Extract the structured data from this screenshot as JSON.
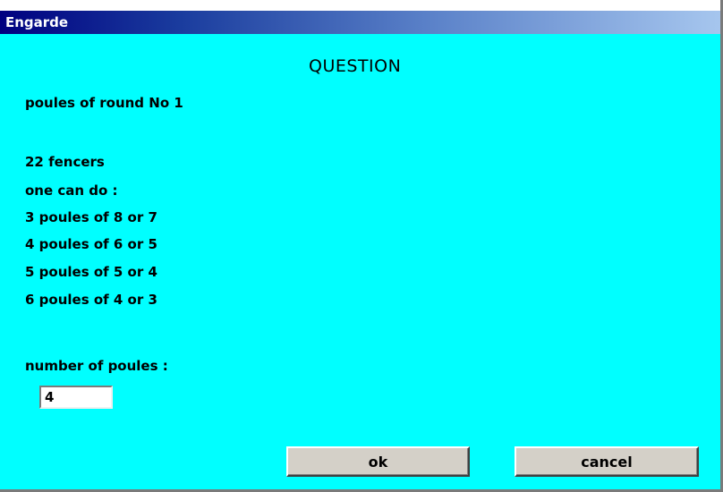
{
  "window": {
    "title": "Engarde"
  },
  "dialog": {
    "heading": "QUESTION",
    "round_line": "poules of round No 1",
    "fencers_line": "22 fencers",
    "intro_line": "one can do :",
    "options": [
      "3 poules of 8 or 7",
      "4 poules of 6 or 5",
      "5 poules of 5 or 4",
      "6 poules of 4 or 3"
    ],
    "input_label": "number of poules :",
    "input_value": "4",
    "ok_label": "ok",
    "cancel_label": "cancel"
  },
  "colors": {
    "background": "#00ffff",
    "titlebar_start": "#000080",
    "titlebar_end": "#a6c6ee",
    "button_face": "#d4d0c8"
  }
}
